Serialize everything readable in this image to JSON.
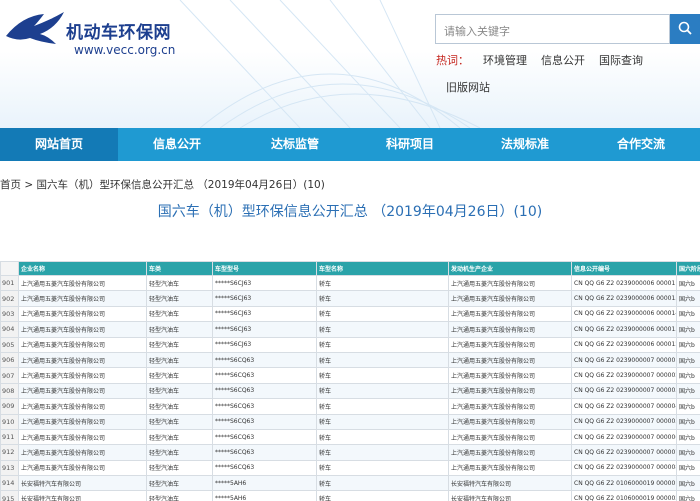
{
  "header": {
    "site_title": "机动车环保网",
    "site_url": "www.vecc.org.cn",
    "search_placeholder": "请输入关键字",
    "hot_label": "热词：",
    "hot_links": [
      "环境管理",
      "信息公开",
      "国际查询"
    ],
    "old_site": "旧版网站"
  },
  "nav": {
    "items": [
      "网站首页",
      "信息公开",
      "达标监管",
      "科研项目",
      "法规标准",
      "合作交流"
    ],
    "active_index": 0
  },
  "breadcrumb": "首页 > 国六车（机）型环保信息公开汇总 （2019年04月26日）(10)",
  "page_title": "国六车（机）型环保信息公开汇总 （2019年04月26日）(10)",
  "table": {
    "headers": [
      "企业名称",
      "车类",
      "车型型号",
      "车型名称",
      "发动机生产企业",
      "信息公开编号",
      "国六阶段"
    ],
    "rows": [
      {
        "rn": "901",
        "cells": [
          "上汽通用五菱汽车股份有限公司",
          "轻型汽油车",
          "*****S6CJ63",
          "轿车",
          "上汽通用五菱汽车股份有限公司",
          "CN QQ G6 Z2 0239000006 000011",
          "国六b"
        ]
      },
      {
        "rn": "902",
        "cells": [
          "上汽通用五菱汽车股份有限公司",
          "轻型汽油车",
          "*****S6CJ63",
          "轿车",
          "上汽通用五菱汽车股份有限公司",
          "CN QQ G6 Z2 0239000006 000015",
          "国六b"
        ]
      },
      {
        "rn": "903",
        "cells": [
          "上汽通用五菱汽车股份有限公司",
          "轻型汽油车",
          "*****S6CJ63",
          "轿车",
          "上汽通用五菱汽车股份有限公司",
          "CN QQ G6 Z2 0239000006 000014",
          "国六b"
        ]
      },
      {
        "rn": "904",
        "cells": [
          "上汽通用五菱汽车股份有限公司",
          "轻型汽油车",
          "*****S6CJ63",
          "轿车",
          "上汽通用五菱汽车股份有限公司",
          "CN QQ G6 Z2 0239000006 000013",
          "国六b"
        ]
      },
      {
        "rn": "905",
        "cells": [
          "上汽通用五菱汽车股份有限公司",
          "轻型汽油车",
          "*****S6CJ63",
          "轿车",
          "上汽通用五菱汽车股份有限公司",
          "CN QQ G6 Z2 0239000006 000012",
          "国六b"
        ]
      },
      {
        "rn": "906",
        "cells": [
          "上汽通用五菱汽车股份有限公司",
          "轻型汽油车",
          "*****S6CQ63",
          "轿车",
          "上汽通用五菱汽车股份有限公司",
          "CN QQ G6 Z2 0239000007 000001",
          "国六b"
        ]
      },
      {
        "rn": "907",
        "cells": [
          "上汽通用五菱汽车股份有限公司",
          "轻型汽油车",
          "*****S6CQ63",
          "轿车",
          "上汽通用五菱汽车股份有限公司",
          "CN QQ G6 Z2 0239000007 000002",
          "国六b"
        ]
      },
      {
        "rn": "908",
        "cells": [
          "上汽通用五菱汽车股份有限公司",
          "轻型汽油车",
          "*****S6CQ63",
          "轿车",
          "上汽通用五菱汽车股份有限公司",
          "CN QQ G6 Z2 0239000007 000003",
          "国六b"
        ]
      },
      {
        "rn": "909",
        "cells": [
          "上汽通用五菱汽车股份有限公司",
          "轻型汽油车",
          "*****S6CQ63",
          "轿车",
          "上汽通用五菱汽车股份有限公司",
          "CN QQ G6 Z2 0239000007 000004",
          "国六b"
        ]
      },
      {
        "rn": "910",
        "cells": [
          "上汽通用五菱汽车股份有限公司",
          "轻型汽油车",
          "*****S6CQ63",
          "轿车",
          "上汽通用五菱汽车股份有限公司",
          "CN QQ G6 Z2 0239000007 000005",
          "国六b"
        ]
      },
      {
        "rn": "911",
        "cells": [
          "上汽通用五菱汽车股份有限公司",
          "轻型汽油车",
          "*****S6CQ63",
          "轿车",
          "上汽通用五菱汽车股份有限公司",
          "CN QQ G6 Z2 0239000007 000006",
          "国六b"
        ]
      },
      {
        "rn": "912",
        "cells": [
          "上汽通用五菱汽车股份有限公司",
          "轻型汽油车",
          "*****S6CQ63",
          "轿车",
          "上汽通用五菱汽车股份有限公司",
          "CN QQ G6 Z2 0239000007 000007",
          "国六b"
        ]
      },
      {
        "rn": "913",
        "cells": [
          "上汽通用五菱汽车股份有限公司",
          "轻型汽油车",
          "*****S6CQ63",
          "轿车",
          "上汽通用五菱汽车股份有限公司",
          "CN QQ G6 Z2 0239000007 000008",
          "国六b"
        ]
      },
      {
        "rn": "914",
        "cells": [
          "长安福特汽车有限公司",
          "轻型汽油车",
          "*****5AH6",
          "轿车",
          "长安福特汽车有限公司",
          "CN QQ G6 Z2 0106000019 000001",
          "国六b"
        ]
      },
      {
        "rn": "915",
        "cells": [
          "长安福特汽车有限公司",
          "轻型汽油车",
          "*****5AH6",
          "轿车",
          "长安福特汽车有限公司",
          "CN QQ G6 Z2 0106000019 000002",
          "国六b"
        ]
      }
    ]
  },
  "colors": {
    "nav_bg": "#1f9ad2",
    "nav_active": "#137ab6",
    "table_header": "#2aa3a9",
    "title_blue": "#2b6fb4",
    "hot_red": "#c4241c"
  }
}
